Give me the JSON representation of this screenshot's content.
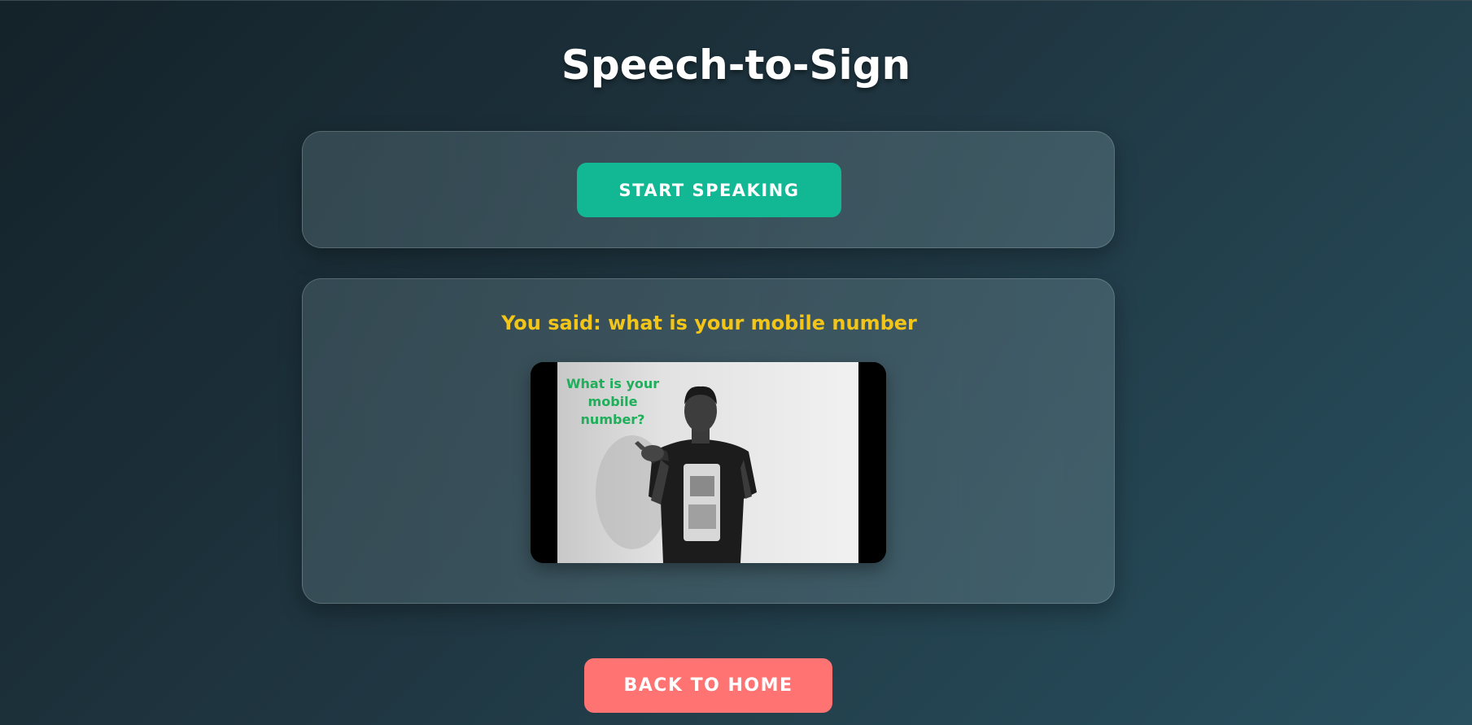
{
  "page": {
    "title": "Speech-to-Sign"
  },
  "controls": {
    "start_label": "START SPEAKING"
  },
  "result": {
    "said_text": "You said: what is your mobile number",
    "video_caption_lines": [
      "What is your",
      "mobile",
      "number?"
    ]
  },
  "footer": {
    "home_label": "BACK TO HOME"
  },
  "colors": {
    "start_button": "#12b894",
    "home_button": "#ff7373",
    "said_text": "#f2c518",
    "caption_text": "#1fae5a"
  }
}
